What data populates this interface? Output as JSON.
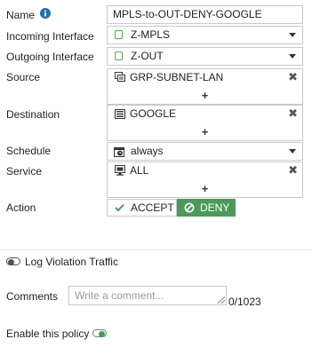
{
  "fields": {
    "name": {
      "label": "Name",
      "value": "MPLS-to-OUT-DENY-GOOGLE"
    },
    "incoming_interface": {
      "label": "Incoming Interface",
      "value": "Z-MPLS"
    },
    "outgoing_interface": {
      "label": "Outgoing Interface",
      "value": "Z-OUT"
    },
    "source": {
      "label": "Source",
      "value": "GRP-SUBNET-LAN",
      "icon": "address-group-icon",
      "add": "+",
      "remove": "✖"
    },
    "destination": {
      "label": "Destination",
      "value": "GOOGLE",
      "icon": "address-icon",
      "add": "+",
      "remove": "✖"
    },
    "schedule": {
      "label": "Schedule",
      "value": "always",
      "icon": "schedule-icon"
    },
    "service": {
      "label": "Service",
      "value": "ALL",
      "icon": "service-icon",
      "add": "+",
      "remove": "✖"
    },
    "action": {
      "label": "Action",
      "accept": "ACCEPT",
      "deny": "DENY",
      "selected": "DENY"
    }
  },
  "log_violation": {
    "label": "Log Violation Traffic",
    "enabled": false
  },
  "comments": {
    "label": "Comments",
    "placeholder": "Write a comment...",
    "counter": "0/1023"
  },
  "enable_policy": {
    "label": "Enable this policy",
    "enabled": true
  },
  "colors": {
    "accent": "#4a9a5a",
    "interface_icon": "#4caf50",
    "info_icon": "#1e6fb8"
  }
}
